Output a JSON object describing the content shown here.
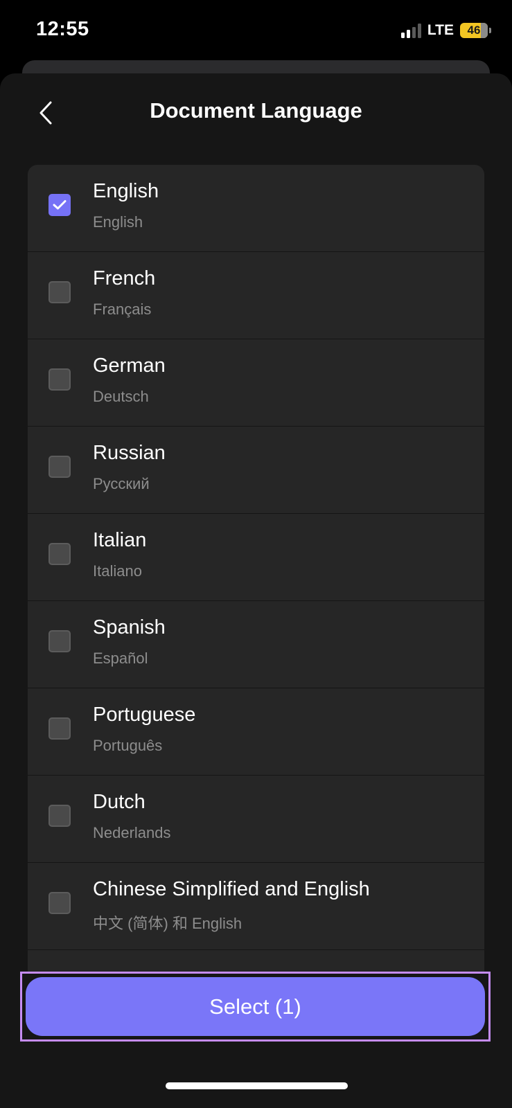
{
  "status_bar": {
    "time": "12:55",
    "network": "LTE",
    "battery": "46"
  },
  "header": {
    "title": "Document Language",
    "back_icon": "chevron-left-icon"
  },
  "languages": [
    {
      "name": "English",
      "native": "English",
      "checked": true
    },
    {
      "name": "French",
      "native": "Français",
      "checked": false
    },
    {
      "name": "German",
      "native": "Deutsch",
      "checked": false
    },
    {
      "name": "Russian",
      "native": "Русский",
      "checked": false
    },
    {
      "name": "Italian",
      "native": "Italiano",
      "checked": false
    },
    {
      "name": "Spanish",
      "native": "Español",
      "checked": false
    },
    {
      "name": "Portuguese",
      "native": "Português",
      "checked": false
    },
    {
      "name": "Dutch",
      "native": "Nederlands",
      "checked": false
    },
    {
      "name": "Chinese Simplified and English",
      "native": "中文 (简体) 和 English",
      "checked": false
    }
  ],
  "footer": {
    "select_label": "Select (1)"
  },
  "colors": {
    "accent": "#7a76f8",
    "checkbox_checked": "#7672f6",
    "highlight_border": "#c58cf2",
    "battery": "#f3c623"
  }
}
